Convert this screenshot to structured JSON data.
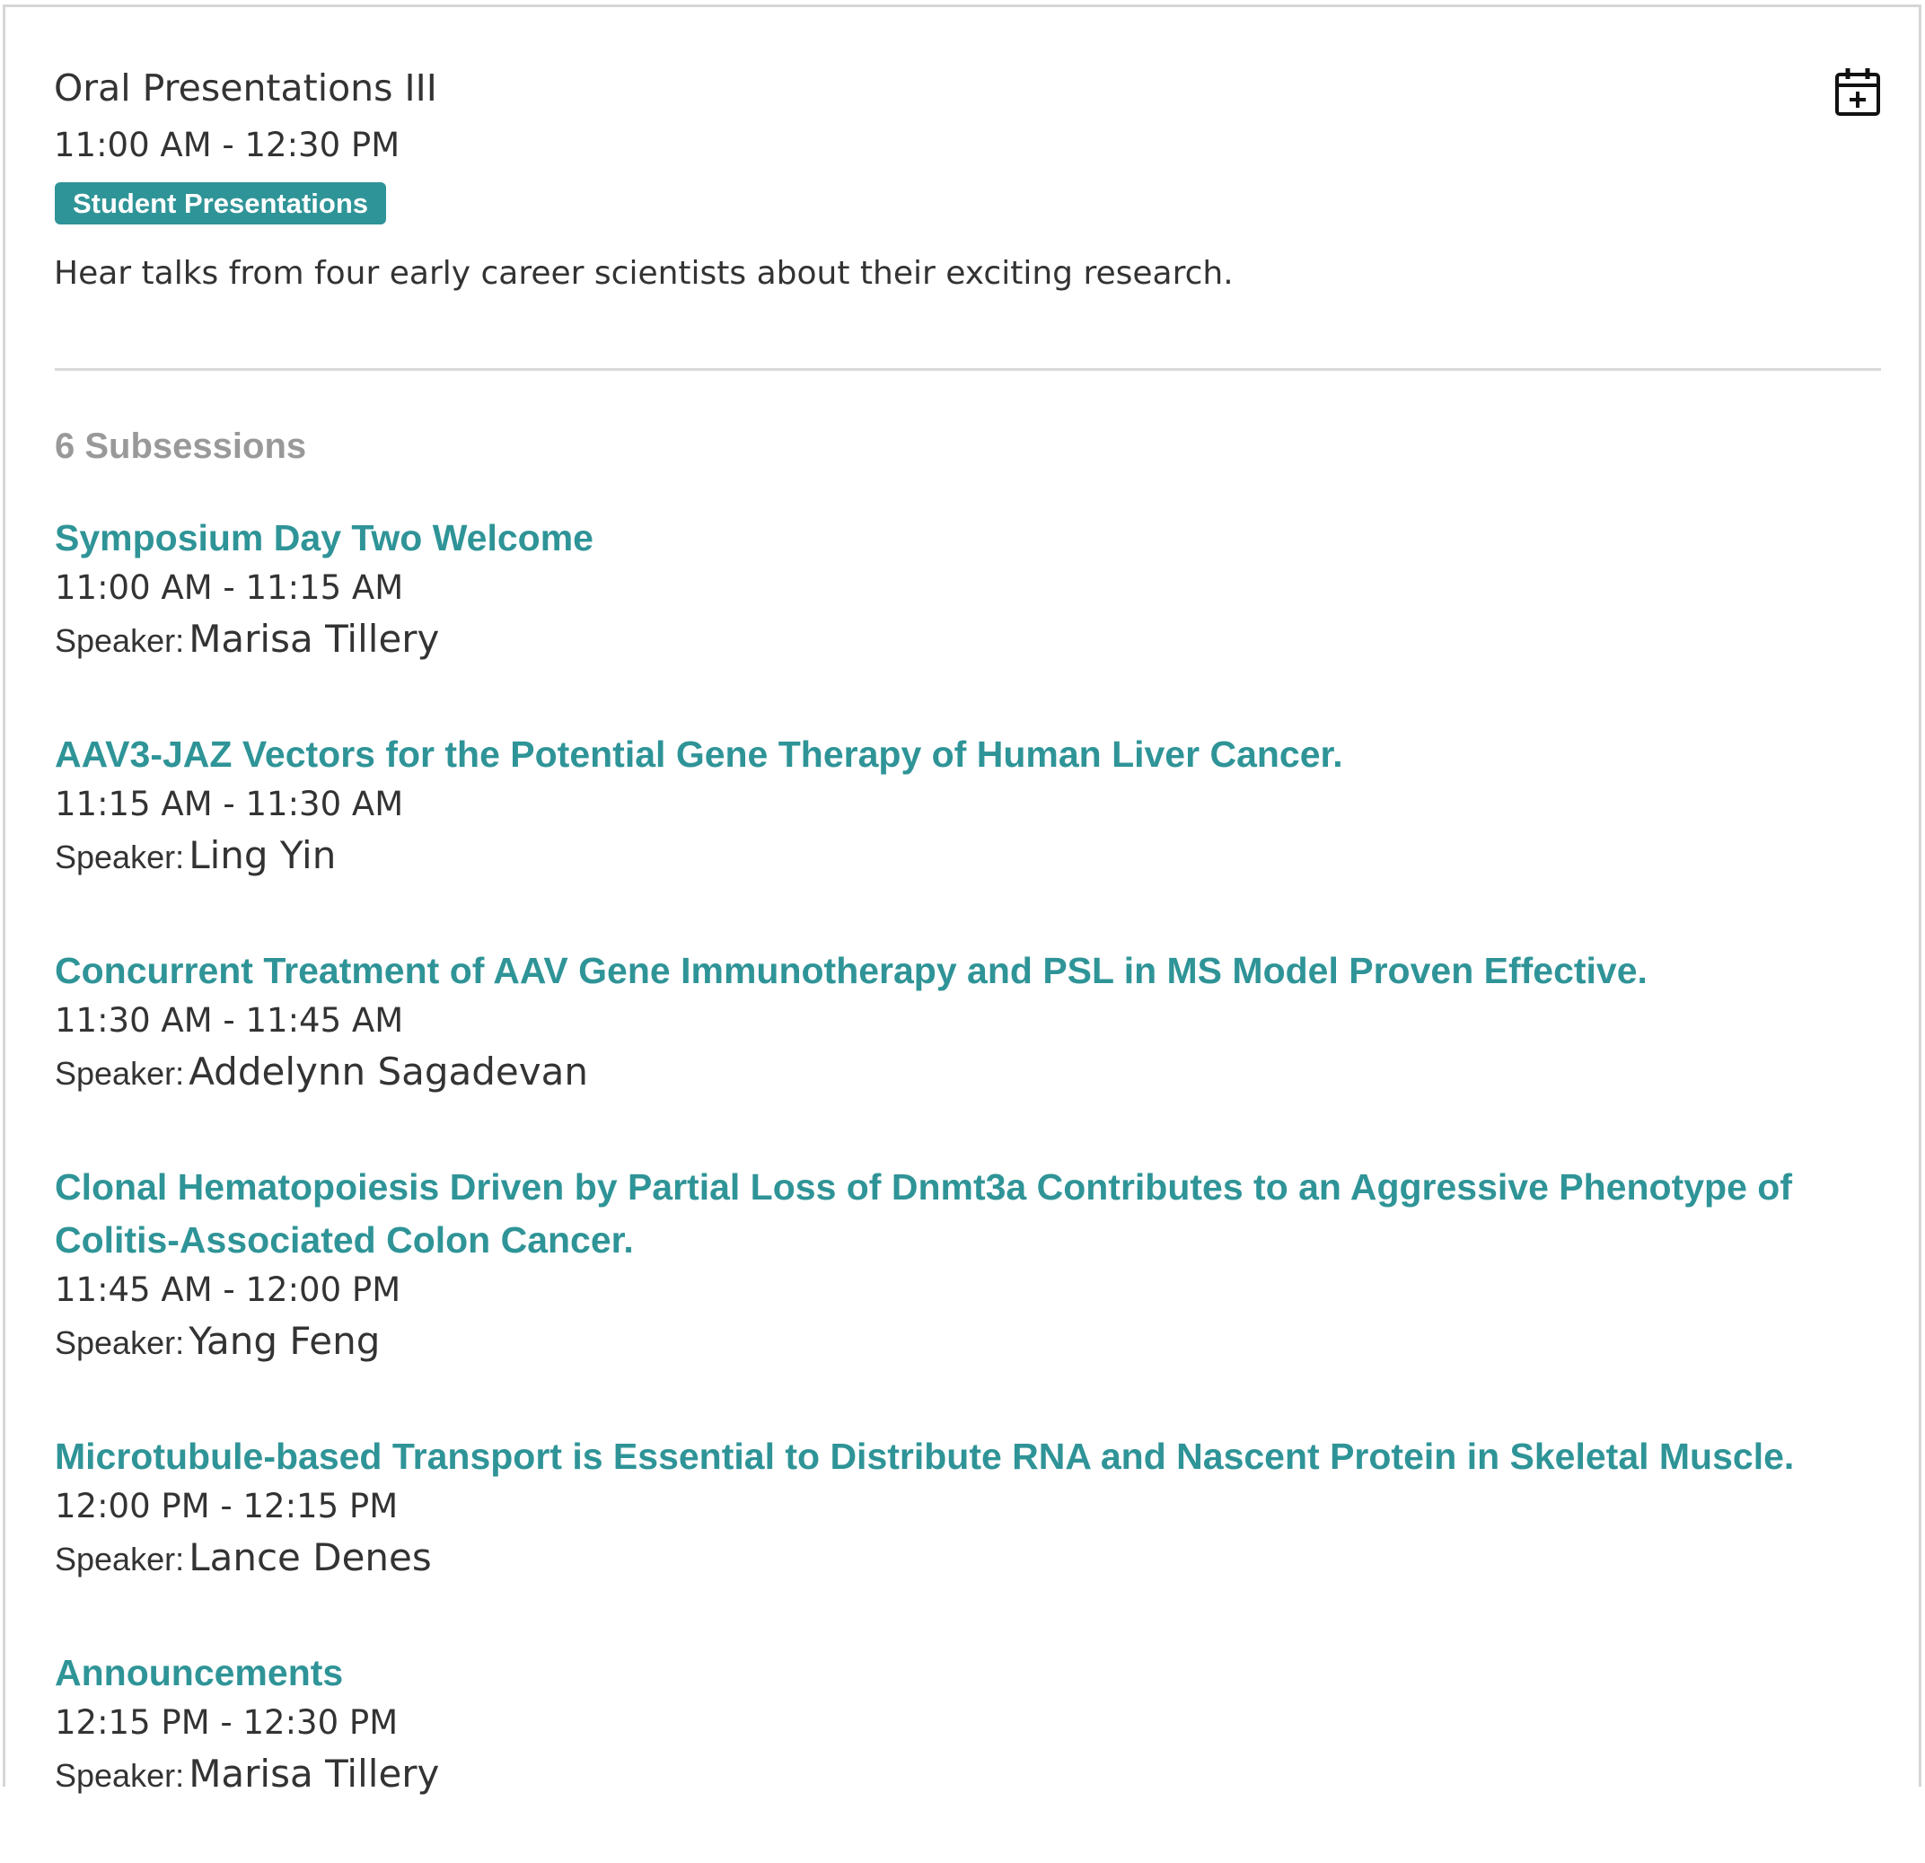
{
  "session": {
    "title": "Oral Presentations III",
    "time": "11:00 AM - 12:30 PM",
    "badge": "Student Presentations",
    "description": "Hear talks from four early career scientists about their exciting research.",
    "add_to_calendar_icon": "calendar-plus-icon"
  },
  "subsessions": {
    "count_label": "6 Subsessions",
    "speaker_label": "Speaker:",
    "items": [
      {
        "title": "Symposium Day Two Welcome",
        "time": "11:00 AM - 11:15 AM",
        "speaker": "Marisa Tillery"
      },
      {
        "title": "AAV3-JAZ Vectors for the Potential Gene Therapy of Human Liver Cancer.",
        "time": "11:15 AM - 11:30 AM",
        "speaker": "Ling Yin"
      },
      {
        "title": "Concurrent Treatment of AAV Gene Immunotherapy and PSL in MS Model Proven Effective.",
        "time": "11:30 AM - 11:45 AM",
        "speaker": "Addelynn Sagadevan"
      },
      {
        "title": "Clonal Hematopoiesis Driven by Partial Loss of Dnmt3a Contributes to an Aggressive Phenotype of Colitis-Associated Colon Cancer.",
        "time": "11:45 AM - 12:00 PM",
        "speaker": "Yang Feng"
      },
      {
        "title": "Microtubule-based Transport is Essential to Distribute RNA and Nascent Protein in Skeletal Muscle.",
        "time": "12:00 PM - 12:15 PM",
        "speaker": "Lance Denes"
      },
      {
        "title": "Announcements",
        "time": "12:15 PM - 12:30 PM",
        "speaker": "Marisa Tillery"
      }
    ]
  },
  "colors": {
    "accent": "#2f9497",
    "text": "#333333",
    "muted": "#999999",
    "divider": "#d9d9d9"
  }
}
